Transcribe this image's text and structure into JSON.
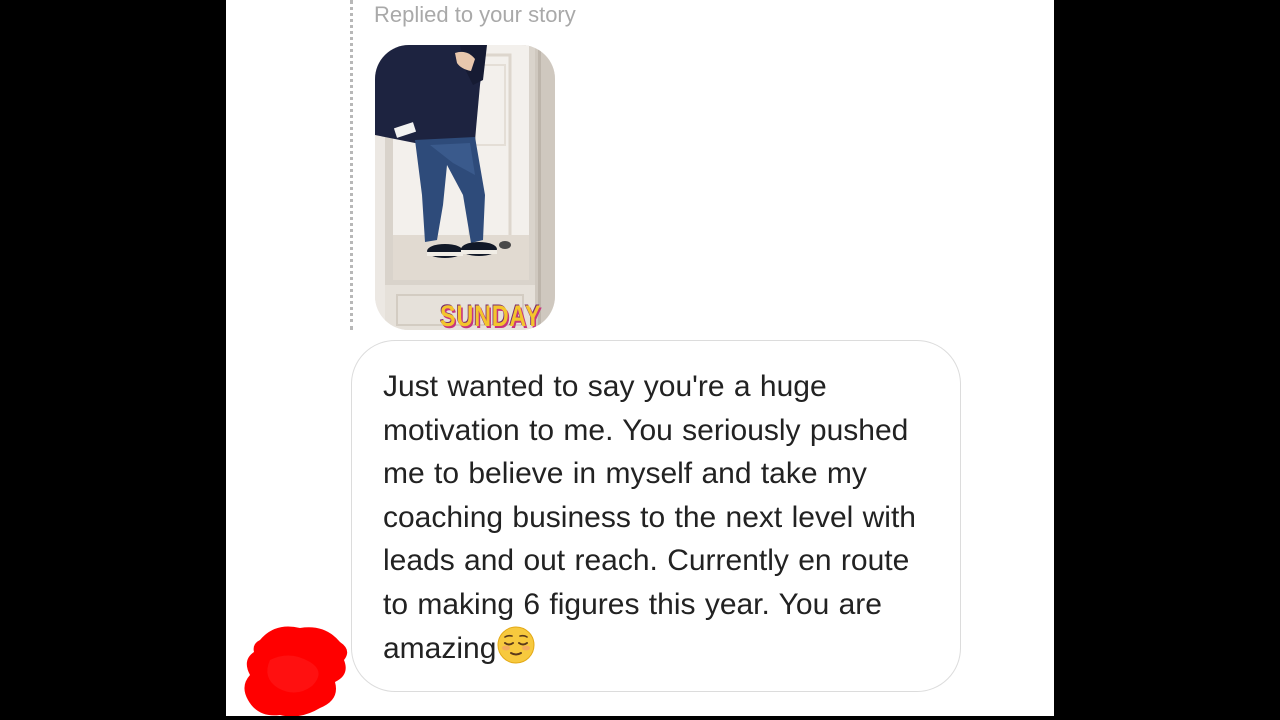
{
  "thread": {
    "reply_context": "Replied to your story",
    "story": {
      "sticker_text": "SUNDAY"
    },
    "message": {
      "text": "Just wanted to say you're a huge motivation to me. You seriously pushed me to believe in myself and take my coaching business to the next level with leads and out reach. Currently en route to making 6 figures this year. You are amazing",
      "trailing_emoji": "relieved-face-emoji"
    },
    "avatar": {
      "state": "redacted",
      "redaction_color": "#ff0000"
    }
  },
  "colors": {
    "background": "#000000",
    "screen": "#ffffff",
    "bubble_border": "#dcdcdc",
    "meta_text": "#a9a9a9",
    "message_text": "#222222"
  }
}
